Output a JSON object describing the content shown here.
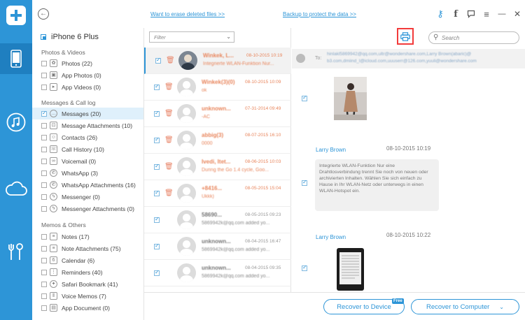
{
  "topbar": {
    "erase_link": "Want to erase deleted files >>",
    "backup_link": "Backup to protect the data >>",
    "icons": [
      "back-arrow-icon",
      "key-icon",
      "facebook-icon",
      "feedback-icon",
      "menu-icon",
      "minimize-icon",
      "close-icon"
    ],
    "key_glyph": "⚷",
    "facebook_glyph": "f",
    "menu_glyph": "≡",
    "min_glyph": "—",
    "close_glyph": "✕"
  },
  "accent_color": "#2d95d7",
  "sidebar": {
    "device": "iPhone 6 Plus",
    "sections": [
      {
        "title": "Photos & Videos",
        "items": [
          {
            "label": "Photos (22)"
          },
          {
            "label": "App Photos (0)"
          },
          {
            "label": "App Videos (0)"
          }
        ]
      },
      {
        "title": "Messages & Call log",
        "items": [
          {
            "label": "Messages (20)"
          },
          {
            "label": "Message Attachments (10)"
          },
          {
            "label": "Contacts (26)"
          },
          {
            "label": "Call History (10)"
          },
          {
            "label": "Voicemail (0)"
          },
          {
            "label": "WhatsApp (3)"
          },
          {
            "label": "WhatsApp Attachments (16)"
          },
          {
            "label": "Messenger (0)"
          },
          {
            "label": "Messenger Attachments (0)"
          }
        ]
      },
      {
        "title": "Memos & Others",
        "items": [
          {
            "label": "Notes (17)"
          },
          {
            "label": "Note Attachments (75)"
          },
          {
            "label": "Calendar (6)"
          },
          {
            "label": "Reminders (40)"
          },
          {
            "label": "Safari Bookmark (41)"
          },
          {
            "label": "Voice Memos (7)"
          },
          {
            "label": "App Document (0)"
          }
        ]
      }
    ]
  },
  "list": {
    "filter_placeholder": "Filter",
    "rows": [
      {
        "name": "Winkek, L...",
        "date": "08-10-2015 10:19",
        "preview": "Integrierte WLAN-Funktion Nur..."
      },
      {
        "name": "Winkek(3)(0)",
        "date": "08-10-2015 10:09",
        "preview": "ok"
      },
      {
        "name": "unknown...",
        "date": "07-31-2014 09:49",
        "preview": "-AC"
      },
      {
        "name": "abbig(3)",
        "date": "08-07-2015 16:10",
        "preview": "0000"
      },
      {
        "name": "Ivedi, Itet...",
        "date": "08-06-2015 10:03",
        "preview": "During the Go 1.4 cycle, Goo..."
      },
      {
        "name": "+8416...",
        "date": "08-05-2015 15:04",
        "preview": "Ukkk)"
      },
      {
        "name": "58690...",
        "date": "08-05-2015 09:23",
        "preview": "5869942k@qq.com added yo..."
      },
      {
        "name": "unknown...",
        "date": "08-04-2015 16:47",
        "preview": "5869942k@qq.com added yo..."
      },
      {
        "name": "unknown...",
        "date": "08-04-2015 09:35",
        "preview": "5869942k@qq.com added yo..."
      }
    ]
  },
  "search": {
    "placeholder": "Search"
  },
  "detail": {
    "to_label": "To:",
    "to_value": "hinlakl5869942@qq.com,ultr@wondershare.com,Larry Brown(abaric)@ b3.com,dmiind_l@icloud.com,uuuserr@126.com,yuuli@wondershare.com",
    "messages": [
      {
        "sender": "Larry Brown",
        "time": "08-10-2015 10:19"
      },
      {
        "sender": "Larry Brown",
        "time": "08-10-2015 10:22"
      }
    ],
    "bubble_text": "Integrierte WLAN-Funktion Nur eine Drahtlosverbindung trennt Sie noch von neuen oder archivierten Inhalten. Wählen Sie sich einfach zu Hause in Ihr WLAN-Netz oder unterwegs in einen WLAN-Hotspot ein."
  },
  "bottombar": {
    "recover_device": "Recover to Device",
    "free_badge": "Free",
    "recover_computer": "Recover to Computer",
    "caret_glyph": "⌄"
  }
}
